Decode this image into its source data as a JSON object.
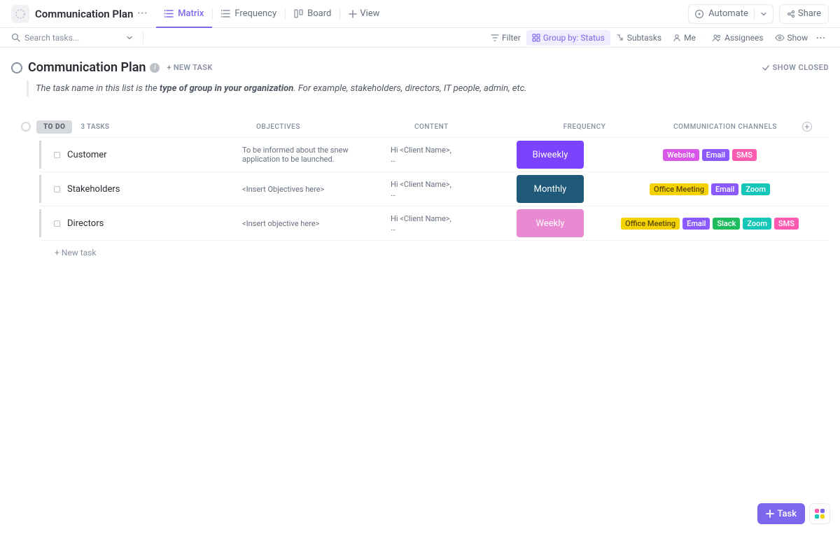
{
  "header": {
    "title": "Communication Plan",
    "views": [
      {
        "label": "Matrix",
        "active": true
      },
      {
        "label": "Frequency",
        "active": false
      },
      {
        "label": "Board",
        "active": false
      }
    ],
    "add_view_label": "View",
    "automate_label": "Automate",
    "share_label": "Share"
  },
  "toolbar": {
    "search_placeholder": "Search tasks...",
    "filter_label": "Filter",
    "group_by_label": "Group by: Status",
    "subtasks_label": "Subtasks",
    "me_label": "Me",
    "assignees_label": "Assignees",
    "show_label": "Show"
  },
  "list": {
    "name": "Communication Plan",
    "new_task_label": "+ NEW TASK",
    "show_closed_label": "SHOW CLOSED",
    "description_prefix": "The task name in this list is the ",
    "description_bold": "type of group in your organization",
    "description_suffix": ". For example, stakeholders, directors, IT people, admin, etc."
  },
  "group": {
    "status_name": "TO DO",
    "task_count": "3 TASKS",
    "bottom_new_task": "+ New task"
  },
  "columns": {
    "objectives": "OBJECTIVES",
    "content": "CONTENT",
    "frequency": "FREQUENCY",
    "channels": "COMMUNICATION CHANNELS"
  },
  "tasks": [
    {
      "name": "Customer",
      "objectives": "To be informed about the snew application to be launched.",
      "content_line1": "Hi <Client Name>,",
      "content_line2": "…",
      "frequency": {
        "label": "Biweekly",
        "class": "freq-biweekly"
      },
      "channels": [
        {
          "label": "Website",
          "class": "tag-website"
        },
        {
          "label": "Email",
          "class": "tag-email"
        },
        {
          "label": "SMS",
          "class": "tag-sms"
        }
      ]
    },
    {
      "name": "Stakeholders",
      "objectives": "<Insert Objectives here>",
      "content_line1": "Hi <Client Name>,",
      "content_line2": "…",
      "frequency": {
        "label": "Monthly",
        "class": "freq-monthly"
      },
      "channels": [
        {
          "label": "Office Meeting",
          "class": "tag-office"
        },
        {
          "label": "Email",
          "class": "tag-email"
        },
        {
          "label": "Zoom",
          "class": "tag-zoom"
        }
      ]
    },
    {
      "name": "Directors",
      "objectives": "<Insert objective here>",
      "content_line1": "Hi <Client Name>,",
      "content_line2": "…",
      "frequency": {
        "label": "Weekly",
        "class": "freq-weekly"
      },
      "channels": [
        {
          "label": "Office Meeting",
          "class": "tag-office"
        },
        {
          "label": "Email",
          "class": "tag-email"
        },
        {
          "label": "Slack",
          "class": "tag-slack"
        },
        {
          "label": "Zoom",
          "class": "tag-zoom"
        },
        {
          "label": "SMS",
          "class": "tag-sms"
        }
      ]
    }
  ],
  "fab": {
    "task_label": "Task"
  }
}
